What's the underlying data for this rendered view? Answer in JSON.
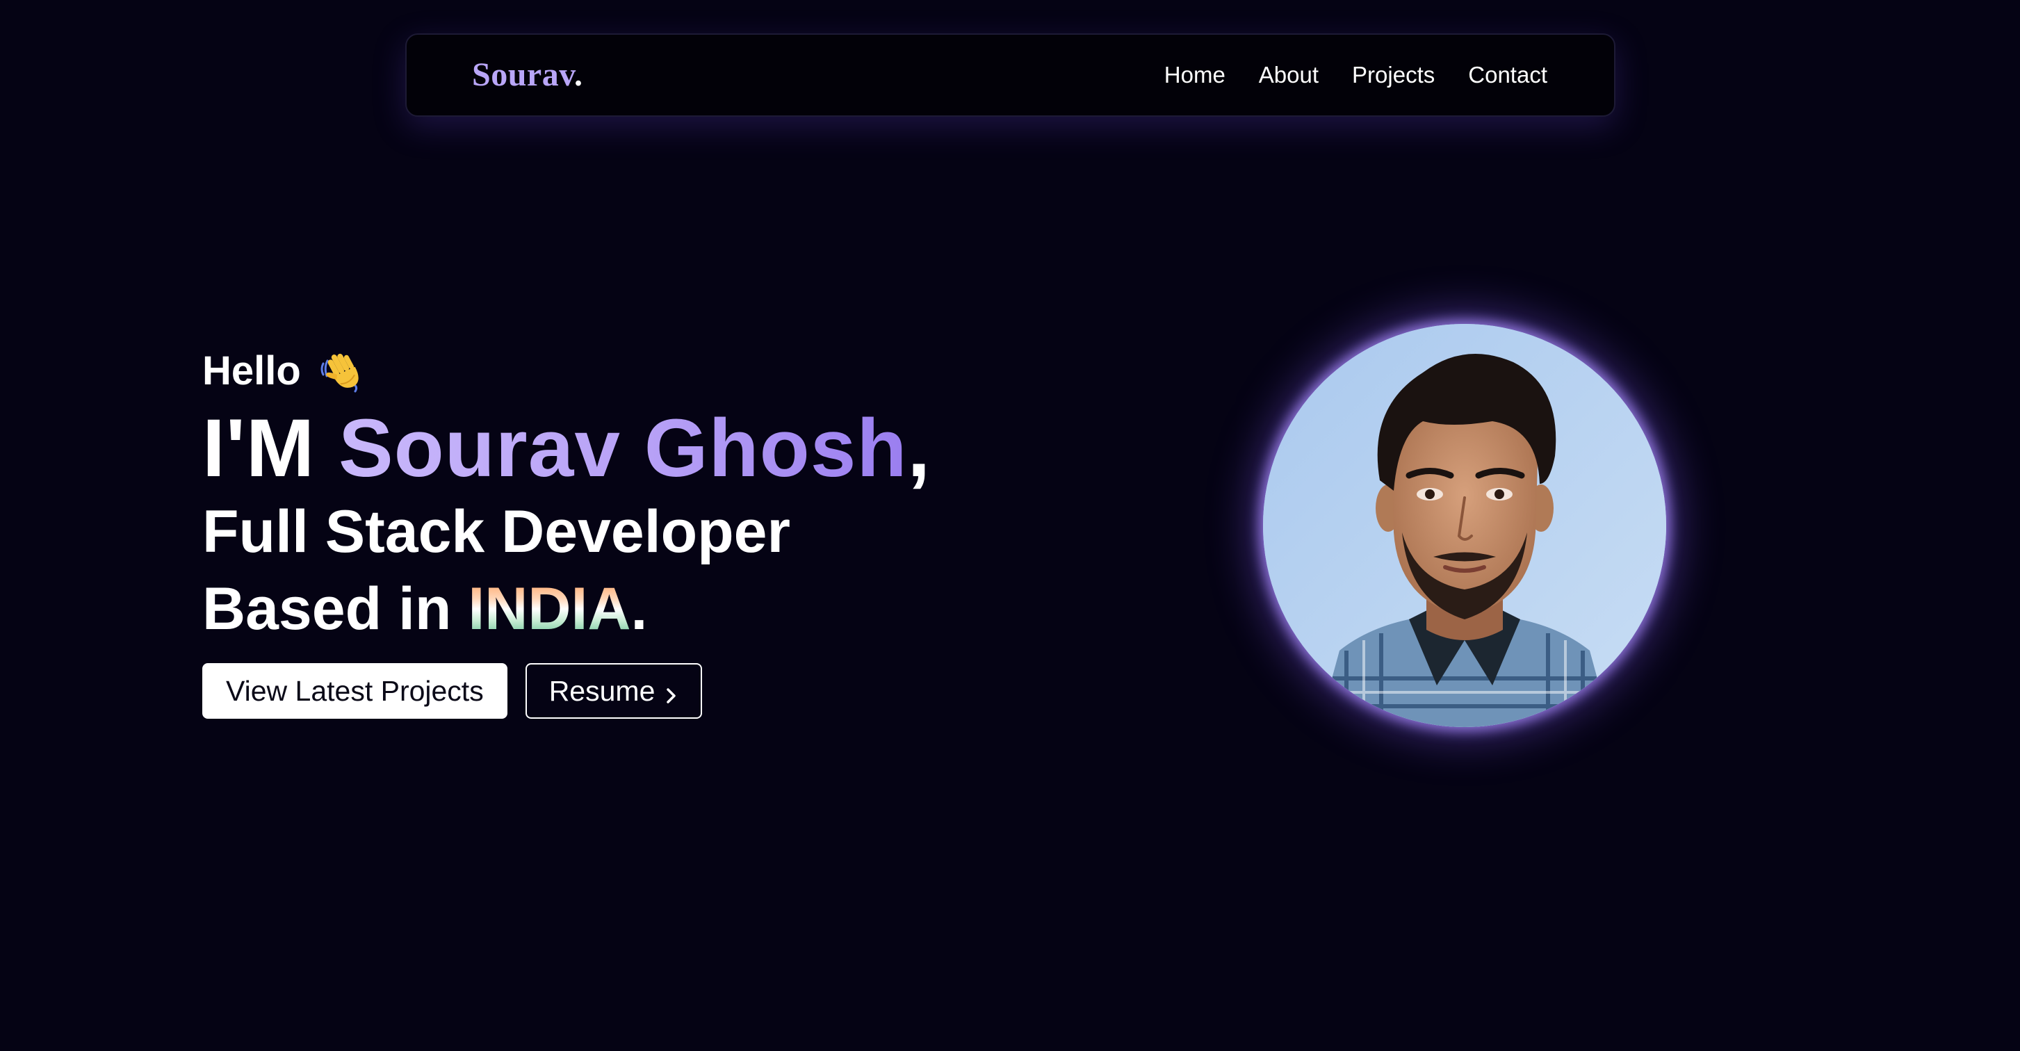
{
  "nav": {
    "brand": "Sourav",
    "brand_dot": ".",
    "links": [
      "Home",
      "About",
      "Projects",
      "Contact"
    ]
  },
  "hero": {
    "greeting": "Hello",
    "greeting_icon": "waving-hand-icon",
    "headline_prefix": "I'M ",
    "name": "Sourav Ghosh",
    "headline_suffix": ",",
    "role": "Full Stack Developer",
    "location_prefix": "Based in ",
    "country": "INDIA",
    "location_suffix": ".",
    "primary_button": "View Latest Projects",
    "secondary_button": "Resume",
    "secondary_button_icon": "chevron-right-icon"
  },
  "avatar": {
    "icon": "profile-photo"
  },
  "colors": {
    "background": "#050314",
    "accent": "#b9a6f7",
    "glow": "#a082f0"
  }
}
